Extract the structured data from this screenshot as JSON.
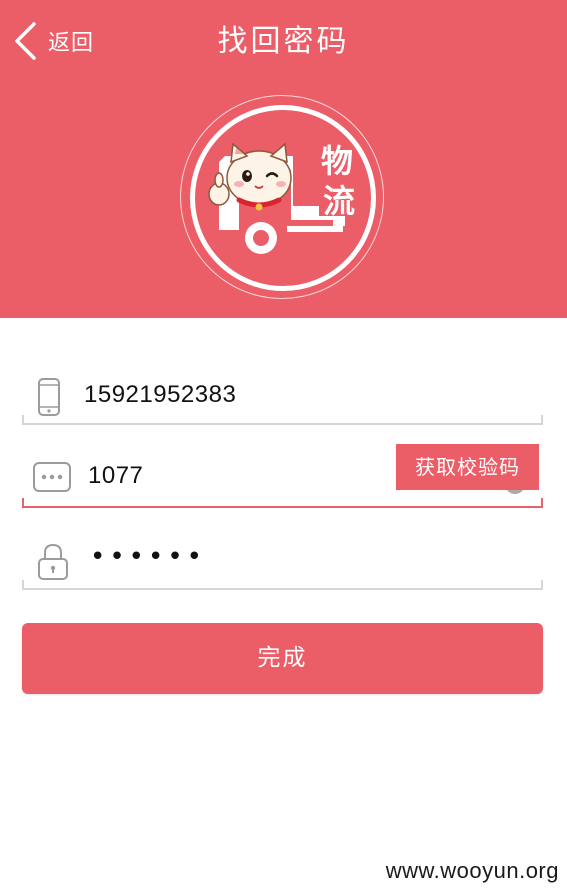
{
  "header": {
    "back_label": "返回",
    "title": "找回密码",
    "logo_chars": [
      "物",
      "流"
    ]
  },
  "form": {
    "phone": {
      "value": "15921952383"
    },
    "code": {
      "value": "1077",
      "get_code_label": "获取校验码"
    },
    "password": {
      "value": "••••••"
    }
  },
  "submit_label": "完成",
  "watermark": "www.wooyun.org",
  "colors": {
    "brand": "#eb5d67",
    "divider": "#d6d6d6",
    "icon_gray": "#9b9b9b"
  }
}
